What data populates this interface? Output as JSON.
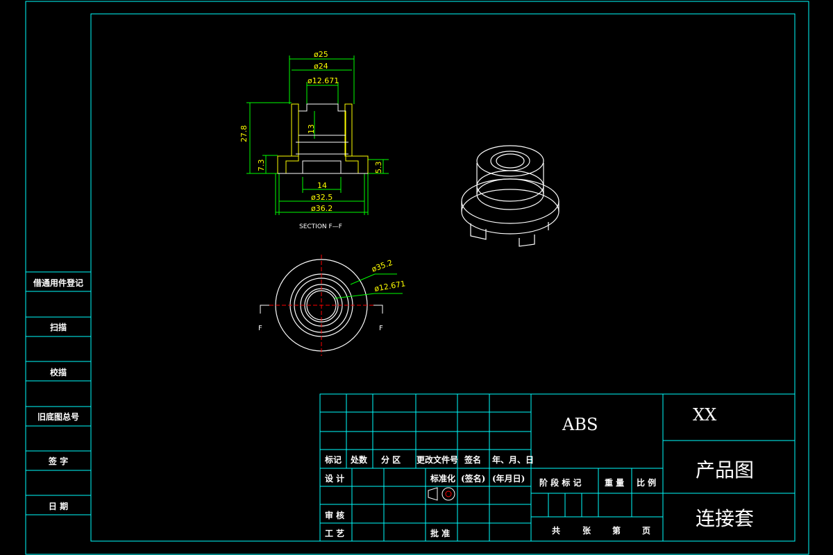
{
  "colors": {
    "background": "#000000",
    "frame": "#00ffff",
    "part": "#ffffff",
    "dimension": "#00ff00",
    "dimension_text": "#ffff00",
    "center_line": "#ff0000",
    "hatch": "#ffff00"
  },
  "side_panel": [
    "借通用件登记",
    "扫描",
    "校描",
    "旧底图总号",
    "签 字",
    "日 期"
  ],
  "section_view": {
    "title": "SECTION F—F",
    "dims": {
      "d25": "ø25",
      "d24": "ø24",
      "d12": "ø12.671",
      "h27": "27.8",
      "h13": "13",
      "h7": "7.3",
      "h5": "5.3",
      "w14": "14",
      "d32": "ø32.5",
      "d36": "ø36.2"
    }
  },
  "top_view": {
    "cut_left": "F",
    "cut_right": "F",
    "d35": "ø35.2",
    "d12": "ø12.671"
  },
  "title_block": {
    "header": [
      "标记",
      "处数",
      "分 区",
      "更改文件号",
      "签名",
      "年、月、日"
    ],
    "design": "设 计",
    "standard": "标准化",
    "sign": "(签名)",
    "date": "(年月日)",
    "review": "审 核",
    "process": "工 艺",
    "approve": "批 准",
    "stage": "阶 段 标 记",
    "weight": "重 量",
    "scale": "比 例",
    "sheets_total": "共",
    "sheets_unit": "张",
    "sheet_no": "第",
    "sheet_page": "页",
    "material": "ABS",
    "company": "XX",
    "drawing_type": "产品图",
    "part_name": "连接套"
  }
}
